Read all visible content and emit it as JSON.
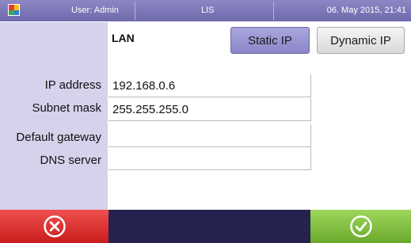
{
  "status_bar": {
    "user": "User: Admin",
    "app_name": "LIS",
    "datetime": "06. May 2015, 21:41"
  },
  "section_title": "LAN",
  "mode_buttons": {
    "static_label": "Static IP",
    "dynamic_label": "Dynamic IP",
    "selected": "Static IP"
  },
  "fields": [
    {
      "label": "IP address",
      "value": "192.168.0.6"
    },
    {
      "label": "Subnet mask",
      "value": "255.255.255.0"
    },
    {
      "label": "Default gateway",
      "value": ""
    },
    {
      "label": "DNS server",
      "value": ""
    }
  ],
  "colors": {
    "header": "#7c77b8",
    "sidebar": "#d5d2ec",
    "selected_button": "#9a96d3",
    "cancel": "#e03232",
    "confirm": "#85c243",
    "footer": "#262250"
  },
  "icons": {
    "cancel": "x-circle-icon",
    "confirm": "check-circle-icon"
  }
}
